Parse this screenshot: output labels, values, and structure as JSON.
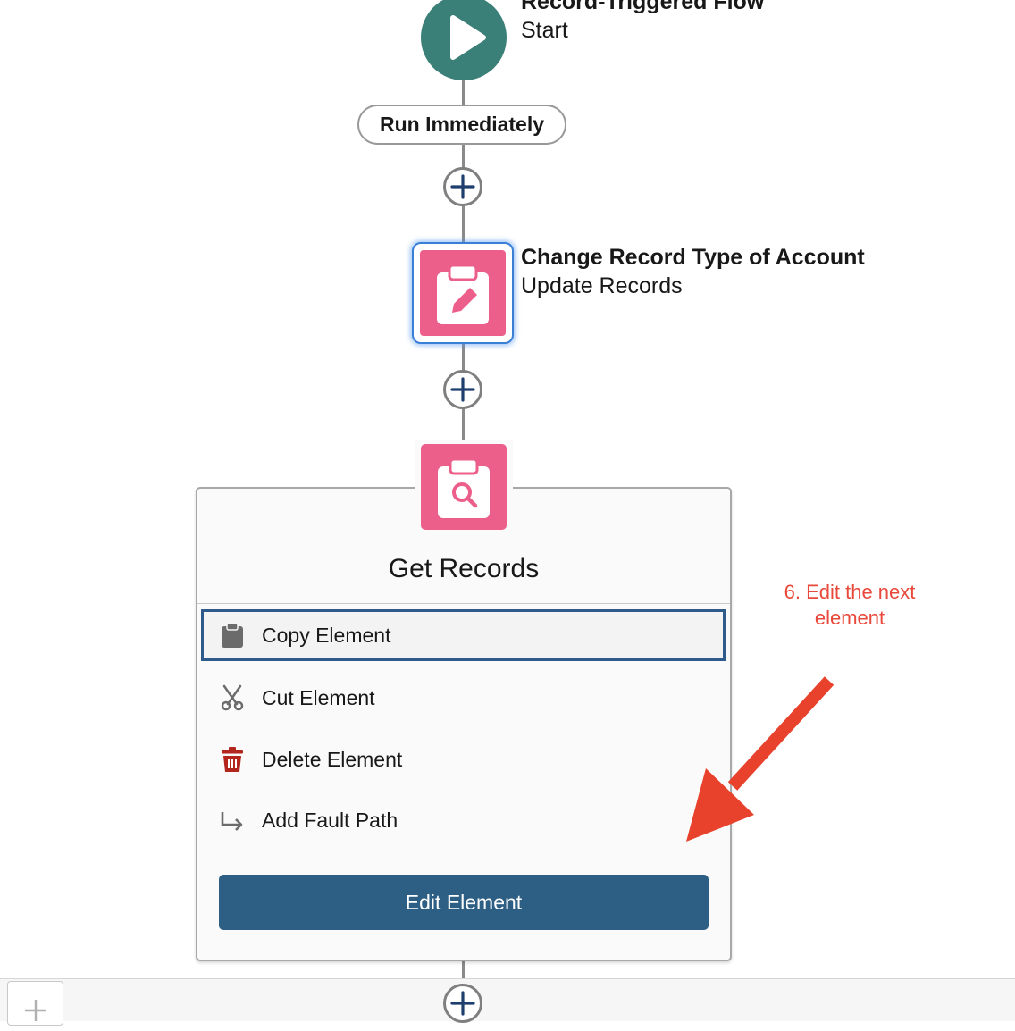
{
  "flow": {
    "start_title": "Record-Triggered Flow",
    "start_subtitle": "Start",
    "run_label": "Run Immediately"
  },
  "update_element": {
    "title": "Change Record Type of Account",
    "subtitle": "Update Records",
    "icon": "clipboard-edit-icon"
  },
  "get_element": {
    "title": "Get Records",
    "icon": "clipboard-search-icon"
  },
  "context_menu": {
    "items": [
      {
        "label": "Copy Element",
        "icon": "clipboard-icon"
      },
      {
        "label": "Cut Element",
        "icon": "scissors-icon"
      },
      {
        "label": "Delete Element",
        "icon": "trash-icon"
      },
      {
        "label": "Add Fault Path",
        "icon": "fault-path-arrow-icon"
      }
    ],
    "edit_button": "Edit Element"
  },
  "annotation": {
    "line1": "6. Edit the next",
    "line2": "element",
    "color": "#e8493b"
  },
  "colors": {
    "start_node": "#3a7f78",
    "element_pink": "#ec5f8b",
    "edit_button": "#2d5f85",
    "selection_border": "#2e5a8c"
  }
}
